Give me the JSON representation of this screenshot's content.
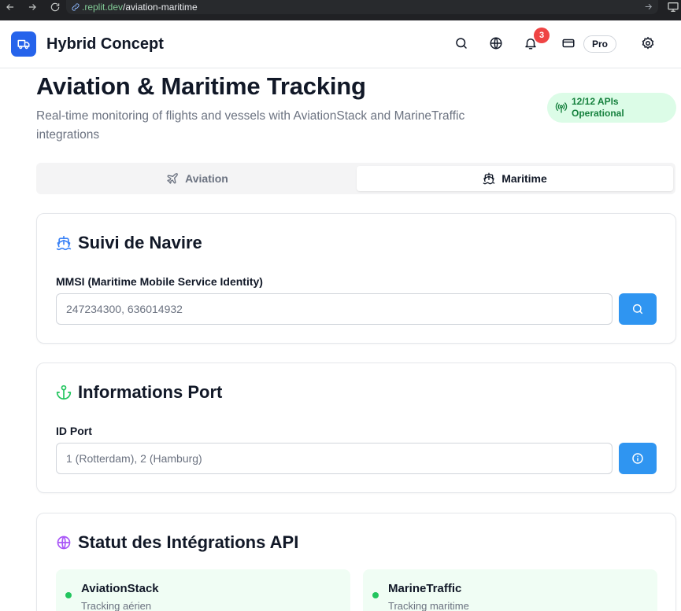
{
  "browser": {
    "url_host": ".replit.dev",
    "url_path": "/aviation-maritime"
  },
  "header": {
    "app_title": "Hybrid Concept",
    "notification_count": "3",
    "plan_label": "Pro"
  },
  "page": {
    "title": "Aviation & Maritime Tracking",
    "subtitle": "Real-time monitoring of flights and vessels with AviationStack and MarineTraffic integrations",
    "api_status_line1": "12/12 APIs",
    "api_status_line2": "Operational"
  },
  "tabs": [
    {
      "label": "Aviation",
      "icon": "plane-icon",
      "active": false
    },
    {
      "label": "Maritime",
      "icon": "ship-icon",
      "active": true
    }
  ],
  "vessel_card": {
    "title": "Suivi de Navire",
    "field_label": "MMSI (Maritime Mobile Service Identity)",
    "placeholder": "247234300, 636014932",
    "value": ""
  },
  "port_card": {
    "title": "Informations Port",
    "field_label": "ID Port",
    "placeholder": "1 (Rotterdam), 2 (Hamburg)",
    "value": ""
  },
  "integrations_card": {
    "title": "Statut des Intégrations API",
    "items": [
      {
        "name": "AviationStack",
        "description": "Tracking aérien",
        "status": "online"
      },
      {
        "name": "MarineTraffic",
        "description": "Tracking maritime",
        "status": "online"
      }
    ]
  },
  "colors": {
    "brand": "#2563eb",
    "action": "#2f95f1",
    "success": "#22c55e",
    "badge": "#ef4444"
  }
}
